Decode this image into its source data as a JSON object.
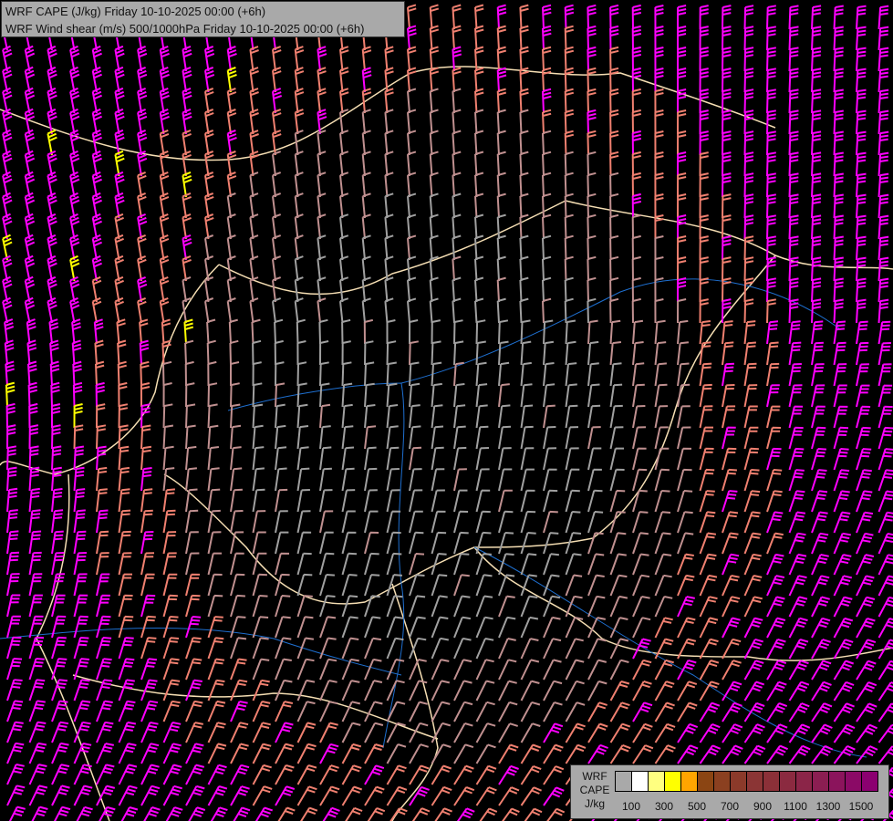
{
  "header": {
    "line1": "WRF CAPE (J/kg) Friday 10-10-2025 00:00 (+6h)",
    "line2": "WRF Wind shear (m/s) 500/1000hPa Friday 10-10-2025 00:00 (+6h)"
  },
  "legend": {
    "label_lines": [
      "WRF",
      "CAPE",
      "J/kg"
    ],
    "swatch_colors": [
      "#a9a9a9",
      "#ffffff",
      "#ffff80",
      "#ffff00",
      "#ffa500",
      "#8b4513",
      "#8b4020",
      "#8b3a2a",
      "#8b3535",
      "#8b3038",
      "#8b2a40",
      "#8b2548",
      "#8b1e52",
      "#8b145c",
      "#8b0a66",
      "#8b0070"
    ],
    "tick_labels": [
      "100",
      "300",
      "500",
      "700",
      "900",
      "1100",
      "1300",
      "1500"
    ]
  },
  "colors": {
    "barb_strong": "#ff00ff",
    "barb_medium": "#f08070",
    "barb_low": "#c09090",
    "barb_weak": "#a0a0a0",
    "barb_extreme": "#ffff00",
    "border": "#f5deb3",
    "river": "#1e6fd0"
  }
}
